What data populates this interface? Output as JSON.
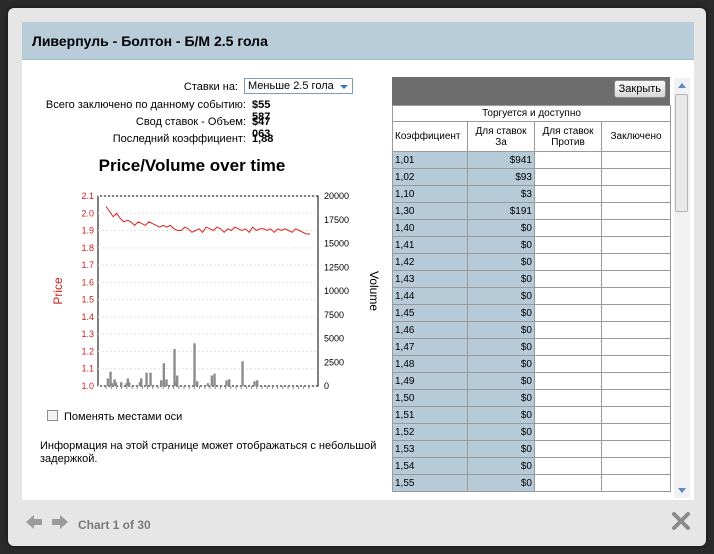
{
  "title": "Ливерпуль - Болтон - Б/М 2.5 гола",
  "info": {
    "bets_on_label": "Ставки на:",
    "bets_on_value": "Меньше 2.5 гола",
    "total_label": "Всего заключено по данному событию:",
    "total_value": "$55 587",
    "volume_label": "Свод ставок - Объем:",
    "volume_value": "$47 063",
    "last_label": "Последний коэффициент:",
    "last_value": "1,88"
  },
  "chart_data": {
    "type": "line",
    "title": "Price/Volume over time",
    "ylabel": "Price",
    "y2label": "Volume",
    "ylim": [
      1.0,
      2.1
    ],
    "y2lim": [
      0,
      20000
    ],
    "yticks": [
      "2.1",
      "2.0",
      "1.9",
      "1.8",
      "1.7",
      "1.6",
      "1.5",
      "1.4",
      "1.3",
      "1.2",
      "1.1",
      "1.0"
    ],
    "y2ticks": [
      "20000",
      "17500",
      "15000",
      "12500",
      "10000",
      "7500",
      "5000",
      "2500",
      "0"
    ],
    "price": [
      2.04,
      2.01,
      1.98,
      2.0,
      1.97,
      1.95,
      1.96,
      1.95,
      1.93,
      1.95,
      1.94,
      1.93,
      1.95,
      1.94,
      1.93,
      1.92,
      1.93,
      1.92,
      1.93,
      1.91,
      1.9,
      1.9,
      1.92,
      1.91,
      1.89,
      1.9,
      1.91,
      1.89,
      1.92,
      1.91,
      1.9,
      1.92,
      1.91,
      1.89,
      1.91,
      1.9,
      1.92,
      1.91,
      1.9,
      1.91,
      1.89,
      1.92,
      1.9,
      1.91,
      1.91,
      1.9,
      1.91,
      1.89,
      1.91,
      1.9,
      1.91,
      1.9,
      1.89,
      1.91,
      1.9,
      1.89,
      1.88,
      1.88
    ],
    "volume": [
      0,
      0,
      800,
      0,
      1500,
      300,
      0,
      700,
      400,
      0,
      0,
      0,
      400,
      0,
      0,
      0,
      300,
      800,
      400,
      0,
      0,
      0,
      0,
      0,
      0,
      0,
      400,
      800,
      0,
      0,
      0,
      1400,
      0,
      0,
      1400,
      0,
      0,
      0,
      0,
      0,
      0,
      0,
      600,
      0,
      2400,
      0,
      700,
      0,
      0,
      0,
      0,
      0,
      3900,
      500,
      1100,
      0,
      0,
      0,
      0,
      0,
      0,
      0,
      0,
      0,
      0,
      0,
      0,
      4500,
      0,
      500,
      0,
      0,
      0,
      0,
      0,
      0,
      0,
      300,
      0,
      0,
      1100,
      0,
      1300,
      0,
      0,
      0,
      0,
      0,
      0,
      0,
      0,
      600,
      0,
      700,
      0,
      0,
      0,
      0,
      0,
      0,
      0,
      0,
      0,
      2600,
      0,
      0,
      0,
      0,
      0,
      0,
      0,
      0,
      500,
      0,
      600,
      0,
      0,
      0,
      0,
      0,
      0,
      0,
      0,
      0,
      0,
      0,
      0,
      0,
      0,
      0,
      0,
      0,
      0,
      0,
      0,
      0,
      0,
      0,
      0,
      0,
      0,
      0,
      0,
      0,
      0,
      0,
      0,
      0,
      0,
      0,
      0,
      0,
      0,
      0,
      0,
      0
    ]
  },
  "swap_axes_label": "Поменять местами оси",
  "notice": "Информация на этой странице может отображаться с небольшой задержкой.",
  "grid": {
    "close_label": "Закрыть",
    "group_header": "Торгуется и доступно",
    "columns": [
      "Коэффициент",
      "Для ставок За",
      "Для ставок Против",
      "Заключено"
    ],
    "rows": [
      [
        "1,01",
        "$941",
        "",
        ""
      ],
      [
        "1,02",
        "$93",
        "",
        ""
      ],
      [
        "1,10",
        "$3",
        "",
        ""
      ],
      [
        "1,30",
        "$191",
        "",
        ""
      ],
      [
        "1,40",
        "$0",
        "",
        ""
      ],
      [
        "1,41",
        "$0",
        "",
        ""
      ],
      [
        "1,42",
        "$0",
        "",
        ""
      ],
      [
        "1,43",
        "$0",
        "",
        ""
      ],
      [
        "1,44",
        "$0",
        "",
        ""
      ],
      [
        "1,45",
        "$0",
        "",
        ""
      ],
      [
        "1,46",
        "$0",
        "",
        ""
      ],
      [
        "1,47",
        "$0",
        "",
        ""
      ],
      [
        "1,48",
        "$0",
        "",
        ""
      ],
      [
        "1,49",
        "$0",
        "",
        ""
      ],
      [
        "1,50",
        "$0",
        "",
        ""
      ],
      [
        "1,51",
        "$0",
        "",
        ""
      ],
      [
        "1,52",
        "$0",
        "",
        ""
      ],
      [
        "1,53",
        "$0",
        "",
        ""
      ],
      [
        "1,54",
        "$0",
        "",
        ""
      ],
      [
        "1,55",
        "$0",
        "",
        ""
      ]
    ]
  },
  "footer": {
    "counter": "Chart 1 of 30"
  },
  "colors": {
    "title_bar": "#b8ccd9",
    "cell_blue": "#b7cad7",
    "price_line": "#e02020",
    "volume_bar": "#8c8c8c",
    "axis_red": "#cc2020"
  }
}
